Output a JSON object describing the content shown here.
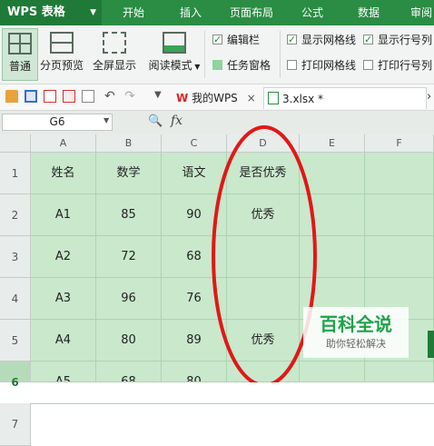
{
  "menubar": {
    "app_name": "WPS 表格",
    "items": [
      "开始",
      "插入",
      "页面布局",
      "公式",
      "数据",
      "审阅"
    ]
  },
  "ribbon": {
    "buttons": [
      {
        "label": "普通",
        "icon": "grid-icon",
        "active": true
      },
      {
        "label": "分页预览",
        "icon": "page-break-icon"
      },
      {
        "label": "全屏显示",
        "icon": "fullscreen-icon"
      },
      {
        "label": "阅读模式",
        "icon": "read-mode-icon",
        "dropdown": true
      }
    ],
    "checkboxes": [
      {
        "label": "编辑栏",
        "checked": true
      },
      {
        "label": "任务窗格",
        "checked": true
      },
      {
        "label": "显示网格线",
        "checked": true
      },
      {
        "label": "显示行号列",
        "checked": true
      },
      {
        "label": "打印网格线",
        "checked": false
      },
      {
        "label": "打印行号列",
        "checked": false
      }
    ]
  },
  "toolbar": {
    "tabs": [
      {
        "label": "我的WPS",
        "icon": "wps-logo-icon",
        "close": "×"
      },
      {
        "label": "3.xlsx *",
        "icon": "spreadsheet-file-icon"
      }
    ],
    "scroll_glyph": "›"
  },
  "formula": {
    "name_box": "G6",
    "fx": "fx"
  },
  "sheet": {
    "columns": [
      "A",
      "B",
      "C",
      "D",
      "E",
      "F"
    ],
    "rows": [
      {
        "num": "1",
        "cells": [
          "姓名",
          "数学",
          "语文",
          "是否优秀",
          "",
          ""
        ]
      },
      {
        "num": "2",
        "cells": [
          "A1",
          "85",
          "90",
          "优秀",
          "",
          ""
        ]
      },
      {
        "num": "3",
        "cells": [
          "A2",
          "72",
          "68",
          "",
          "",
          ""
        ]
      },
      {
        "num": "4",
        "cells": [
          "A3",
          "96",
          "76",
          "",
          "",
          ""
        ]
      },
      {
        "num": "5",
        "cells": [
          "A4",
          "80",
          "89",
          "优秀",
          "",
          ""
        ]
      },
      {
        "num": "6",
        "cells": [
          "A5",
          "68",
          "80",
          "",
          "",
          ""
        ],
        "selected": true
      },
      {
        "num": "7",
        "cells": [
          "",
          "",
          "",
          "",
          "",
          ""
        ]
      }
    ]
  },
  "watermark": {
    "title": "百科全说",
    "subtitle": "助你轻松解决"
  },
  "colors": {
    "menubar": "#2a8d43",
    "grid_fill": "#c9e8cc",
    "annotation": "#e01818"
  }
}
